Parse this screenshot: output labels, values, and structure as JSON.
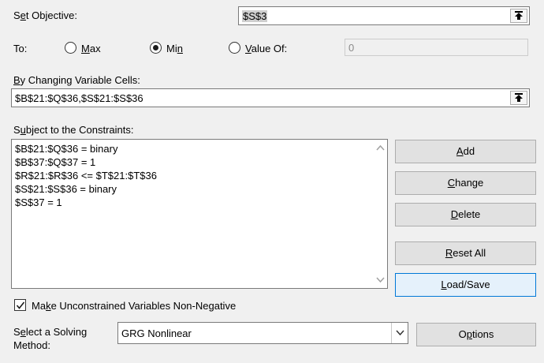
{
  "objective": {
    "label_pre": "S",
    "label_ul": "e",
    "label_post": "t Objective:",
    "value": "$S$3"
  },
  "to": {
    "label": "To:",
    "options": [
      {
        "ul": "M",
        "rest": "ax",
        "selected": false
      },
      {
        "pre": "Mi",
        "ul": "n",
        "rest": "",
        "selected": true
      },
      {
        "ul": "V",
        "rest": "alue Of:",
        "selected": false
      }
    ],
    "value_of": "0"
  },
  "changing": {
    "label_ul": "B",
    "label_rest": "y Changing Variable Cells:",
    "value": "$B$21:$Q$36,$S$21:$S$36"
  },
  "constraints": {
    "label_pre": "S",
    "label_ul": "u",
    "label_rest": "bject to the Constraints:",
    "items": [
      "$B$21:$Q$36 = binary",
      "$B$37:$Q$37 = 1",
      "$R$21:$R$36 <= $T$21:$T$36",
      "$S$21:$S$36 = binary",
      "$S$37 = 1"
    ]
  },
  "buttons": {
    "add": {
      "ul": "A",
      "rest": "dd"
    },
    "change": {
      "ul": "C",
      "rest": "hange"
    },
    "delete": {
      "ul": "D",
      "rest": "elete"
    },
    "reset": {
      "ul": "R",
      "rest": "eset All"
    },
    "load": {
      "ul": "L",
      "rest": "oad/Save"
    },
    "options": {
      "pre": "O",
      "ul": "p",
      "rest": "tions"
    }
  },
  "nonneg": {
    "pre": "Ma",
    "ul": "k",
    "rest": "e Unconstrained Variables Non-Negative",
    "checked": true
  },
  "method": {
    "line1_pre": "S",
    "line1_ul": "e",
    "line1_rest": "lect a Solving",
    "line2": "Method:",
    "value": "GRG Nonlinear"
  }
}
